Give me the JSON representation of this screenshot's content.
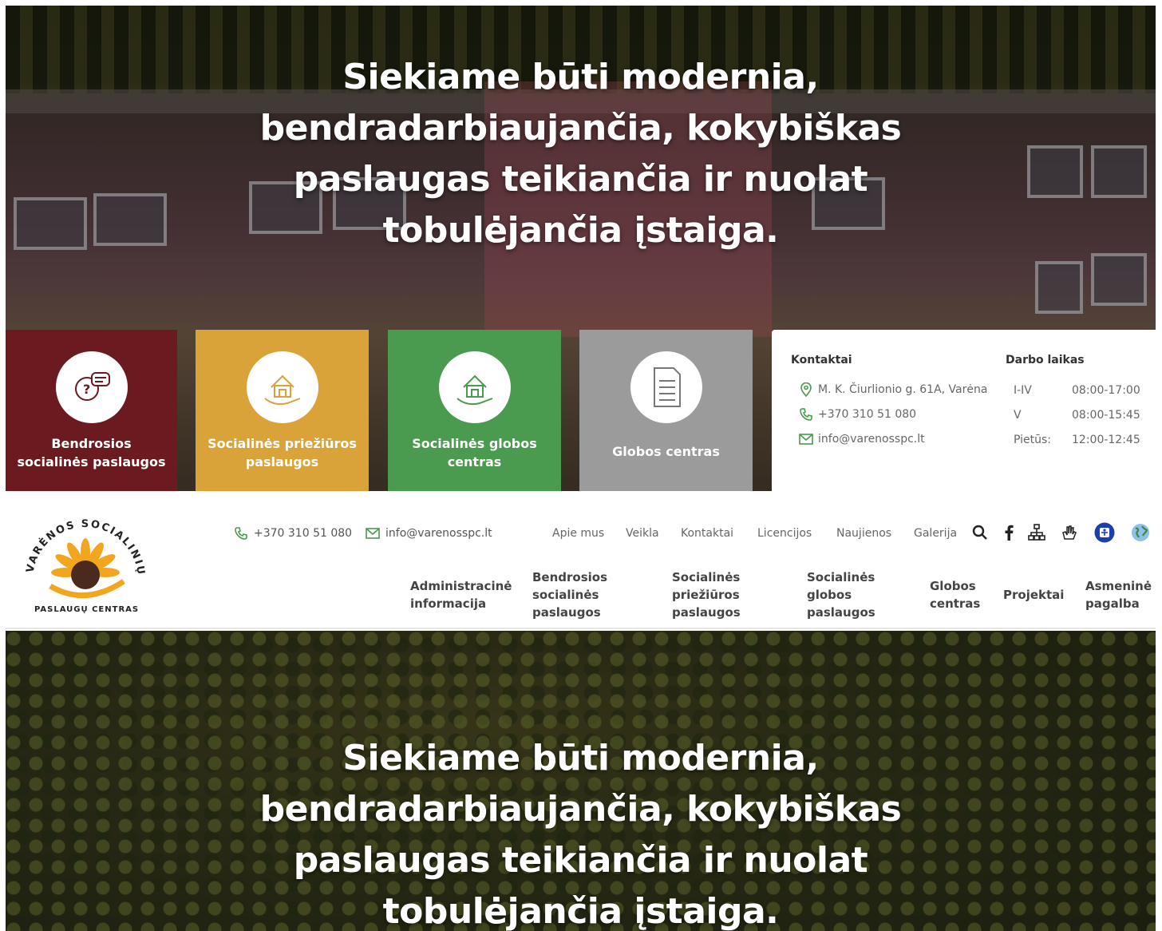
{
  "hero": {
    "line1": "Siekiame būti modernia,",
    "line2": "bendradarbiaujančia, kokybiškas",
    "line3": "paslaugas teikiančia ir nuolat",
    "line4": "tobulėjančia įstaiga."
  },
  "service_cards": [
    {
      "line1": "Bendrosios",
      "line2": "socialinės paslaugos",
      "color": "#6b1a1f",
      "icon": "chat-question-icon"
    },
    {
      "line1": "Socialinės priežiūros",
      "line2": "paslaugos",
      "color": "#d9a33a",
      "icon": "house-hand-icon"
    },
    {
      "line1": "Socialinės globos",
      "line2": "centras",
      "color": "#4a9a4f",
      "icon": "house-hand-icon"
    },
    {
      "line1": "Globos centras",
      "line2": "",
      "color": "#9b9b9b",
      "icon": "document-list-icon"
    }
  ],
  "contacts": {
    "heading": "Kontaktai",
    "address": "M. K. Čiurlionio g. 61A, Varėna",
    "phone": "+370 310 51 080",
    "email": "info@varenosspc.lt"
  },
  "hours": {
    "heading": "Darbo laikas",
    "rows": [
      {
        "day": "I-IV",
        "time": "08:00-17:00"
      },
      {
        "day": "V",
        "time": "08:00-15:45"
      },
      {
        "day": "Pietūs:",
        "time": "12:00-12:45"
      }
    ]
  },
  "logo": {
    "arc_text": "VARĖNOS SOCIALINIŲ",
    "bottom_text": "PASLAUGŲ CENTRAS"
  },
  "topbar": {
    "phone": "+370 310 51 080",
    "email": "info@varenosspc.lt",
    "links": [
      "Apie mus",
      "Veikla",
      "Kontaktai",
      "Licencijos",
      "Naujienos",
      "Galerija"
    ]
  },
  "icons": [
    "search-icon",
    "facebook-icon",
    "sitemap-icon",
    "sign-language-icon",
    "accessibility-icon",
    "globe-icon"
  ],
  "mainnav": {
    "admin": [
      "Administracinė",
      "informacija"
    ],
    "bendrosios": [
      "Bendrosios",
      "socialinės",
      "paslaugos"
    ],
    "prieziuros": [
      "Socialinės",
      "priežiūros",
      "paslaugos"
    ],
    "globos": [
      "Socialinės",
      "globos",
      "paslaugos"
    ],
    "globos_centras": [
      "Globos",
      "centras"
    ],
    "projektai": [
      "Projektai"
    ],
    "asmenine": [
      "Asmeninė",
      "pagalba"
    ]
  },
  "colors": {
    "card_maroon": "#6b1a1f",
    "card_yellow": "#d9a33a",
    "card_green": "#4a9a4f",
    "card_grey": "#9b9b9b",
    "accent_green": "#4a9a4f"
  }
}
